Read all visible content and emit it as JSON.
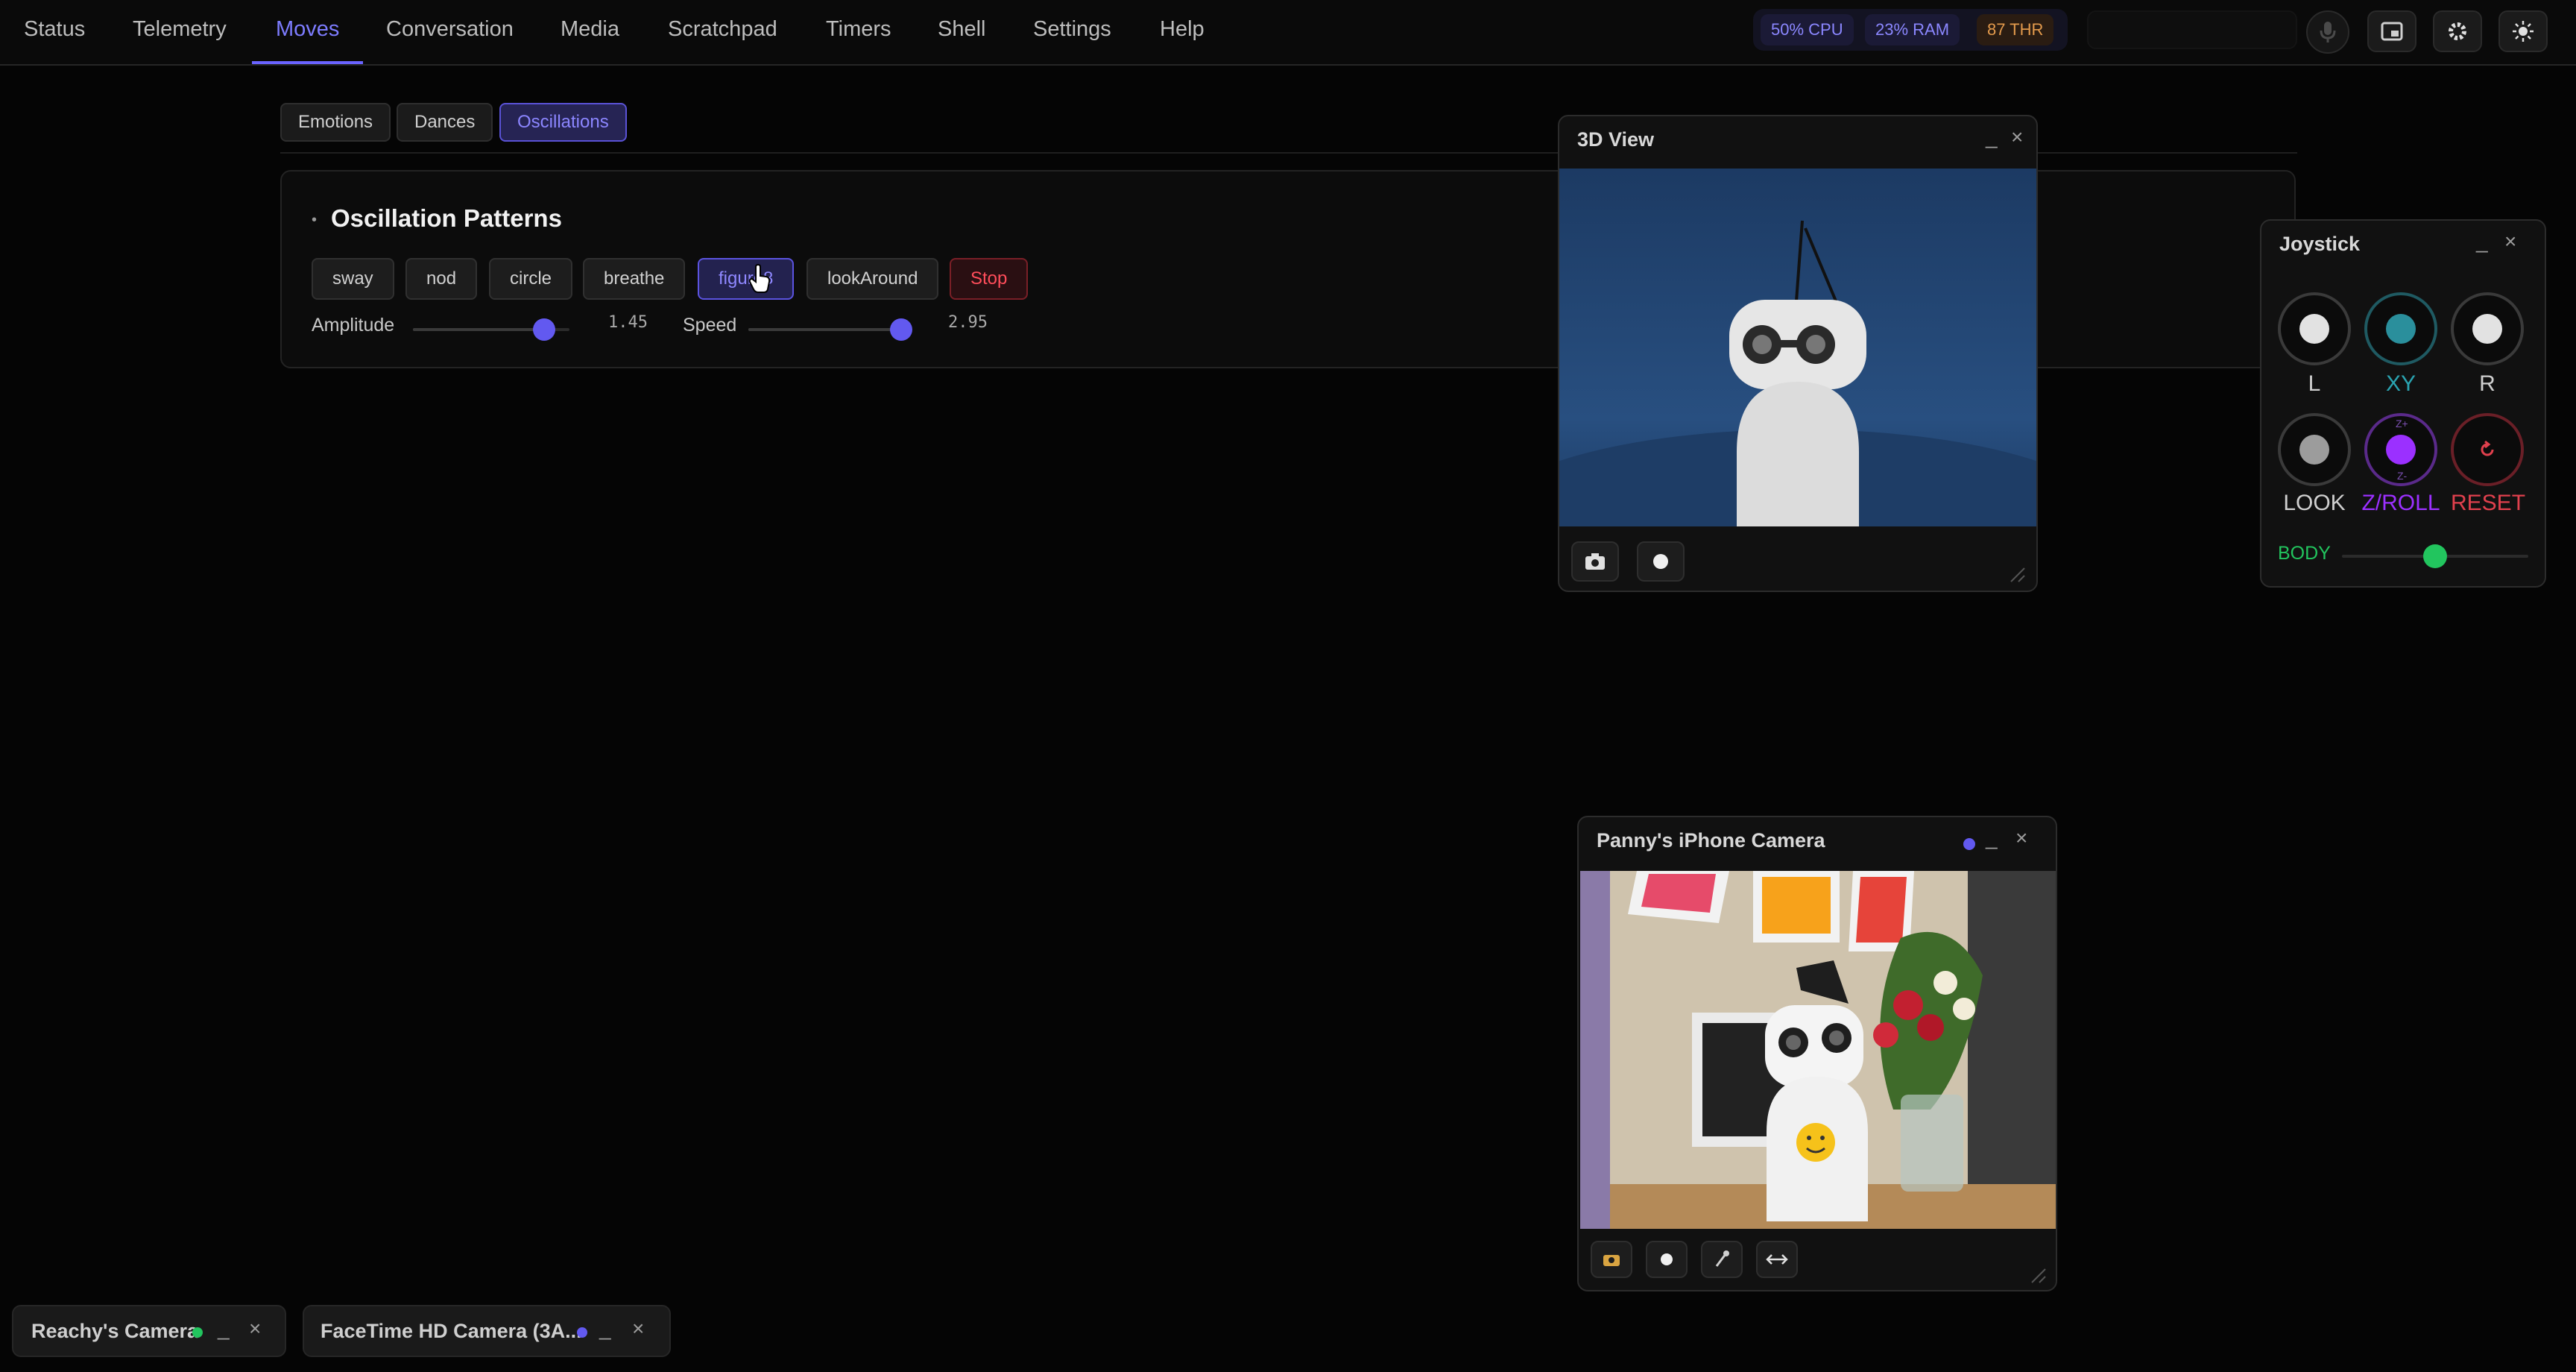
{
  "nav": {
    "tabs": [
      "Status",
      "Telemetry",
      "Moves",
      "Conversation",
      "Media",
      "Scratchpad",
      "Timers",
      "Shell",
      "Settings",
      "Help"
    ],
    "active_tab": "Moves"
  },
  "stats": {
    "cpu": "50% CPU",
    "ram": "23% RAM",
    "thr": "87 THR"
  },
  "moves": {
    "subtabs": [
      "Emotions",
      "Dances",
      "Oscillations"
    ],
    "active_subtab": "Oscillations",
    "panel_title": "Oscillation Patterns",
    "patterns": [
      "sway",
      "nod",
      "circle",
      "breathe",
      "figure8",
      "lookAround"
    ],
    "active_pattern": "figure8",
    "stop_label": "Stop",
    "amplitude": {
      "label": "Amplitude",
      "value": "1.45",
      "level": 0.84
    },
    "speed": {
      "label": "Speed",
      "value": "2.95",
      "level": 0.98
    }
  },
  "view3d": {
    "title": "3D View",
    "min": "_",
    "close": "×"
  },
  "joystick": {
    "title": "Joystick",
    "min": "_",
    "close": "×",
    "labels": {
      "l": "L",
      "xy": "XY",
      "r": "R",
      "look": "LOOK",
      "zroll": "Z/ROLL",
      "reset": "RESET",
      "z_plus": "Z+",
      "z_minus": "Z-"
    },
    "body_label": "BODY",
    "body_level": 0.5
  },
  "phone_camera": {
    "title": "Panny's iPhone Camera",
    "min": "_",
    "close": "×"
  },
  "dock": {
    "items": [
      {
        "label": "Reachy's Camera",
        "dot_color": "#22c55e",
        "min": "_",
        "close": "×"
      },
      {
        "label": "FaceTime HD Camera (3A...",
        "dot_color": "#6259f0",
        "min": "_",
        "close": "×"
      }
    ]
  },
  "colors": {
    "accent": "#6a63ff",
    "stop": "#ff4d5a",
    "body_green": "#22c55e",
    "zroll_purple": "#9b30ff",
    "xy_teal": "#2aa3b0"
  }
}
